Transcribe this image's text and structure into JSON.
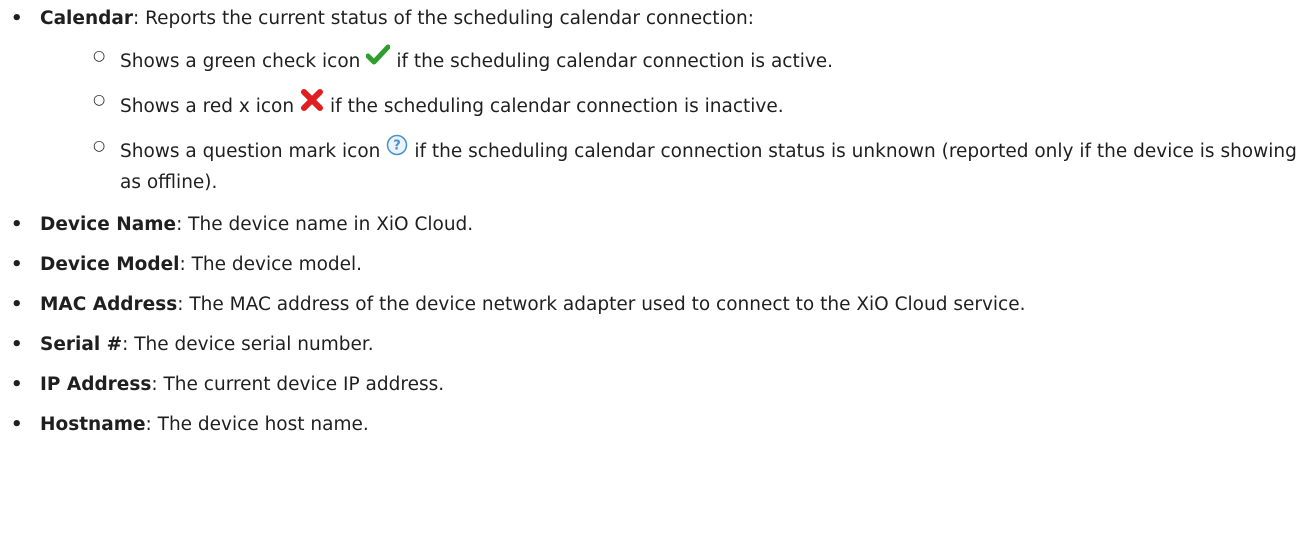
{
  "items": [
    {
      "term": "Calendar",
      "text": ": Reports the current status of the scheduling calendar connection:",
      "subitems": [
        {
          "before": "Shows a green check icon",
          "icon": "green-check-icon",
          "after": "if the scheduling calendar connection is active."
        },
        {
          "before": "Shows a red x icon",
          "icon": "red-x-icon",
          "after": "if the scheduling calendar connection is inactive."
        },
        {
          "before": "Shows a question mark icon",
          "icon": "question-mark-icon",
          "after": "if the scheduling calendar connection status is unknown (reported only if the device is showing as offline)."
        }
      ]
    },
    {
      "term": "Device Name",
      "text": ": The device name in XiO Cloud."
    },
    {
      "term": "Device Model",
      "text": ": The device model."
    },
    {
      "term": "MAC Address",
      "text": ": The MAC address of the device network adapter used to connect to the XiO Cloud service."
    },
    {
      "term": "Serial #",
      "text": ": The device serial number."
    },
    {
      "term": "IP Address",
      "text": ": The current device IP address."
    },
    {
      "term": "Hostname",
      "text": ": The device host name."
    }
  ],
  "colors": {
    "text": "#1f1f1f",
    "check": "#2e9e2e",
    "cross": "#e02020",
    "question": "#4a90c9"
  }
}
